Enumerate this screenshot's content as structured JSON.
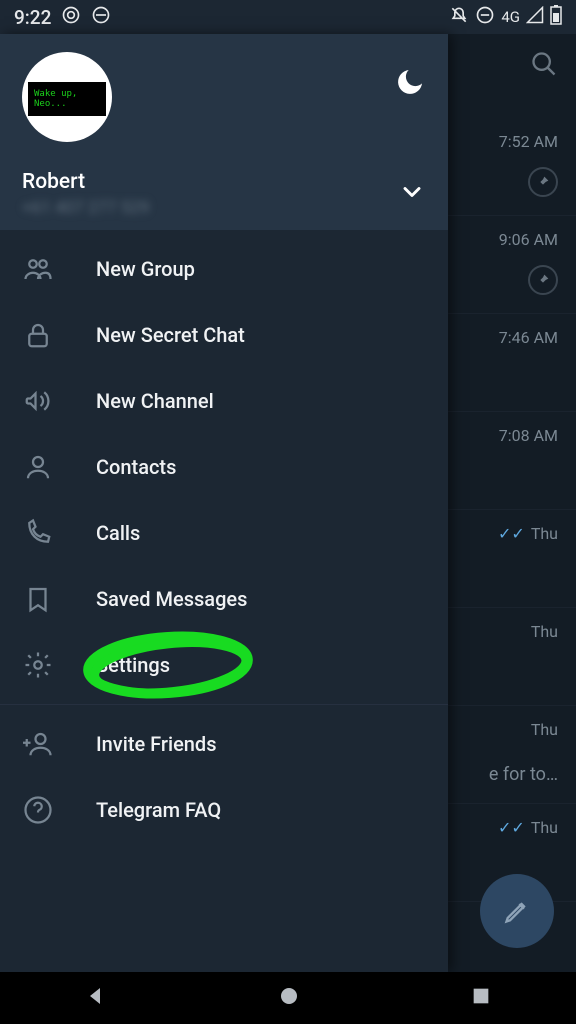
{
  "status": {
    "time": "9:22",
    "network": "4G"
  },
  "drawer": {
    "avatar_text": "Wake up, Neo...",
    "name": "Robert",
    "phone": "+61 407 277 529",
    "items": {
      "new_group": "New Group",
      "new_secret_chat": "New Secret Chat",
      "new_channel": "New Channel",
      "contacts": "Contacts",
      "calls": "Calls",
      "saved_messages": "Saved Messages",
      "settings": "Settings",
      "invite_friends": "Invite Friends",
      "telegram_faq": "Telegram FAQ"
    }
  },
  "chats": {
    "r0": {
      "time": "7:52 AM",
      "preview": "/"
    },
    "r1": {
      "time": "9:06 AM"
    },
    "r2": {
      "time": "7:46 AM"
    },
    "r3": {
      "time": "7:08 AM"
    },
    "r4": {
      "time": "Thu"
    },
    "r5": {
      "time": "Thu"
    },
    "r6": {
      "time": "Thu",
      "preview": "e for to…"
    },
    "r7": {
      "time": "Thu"
    }
  }
}
